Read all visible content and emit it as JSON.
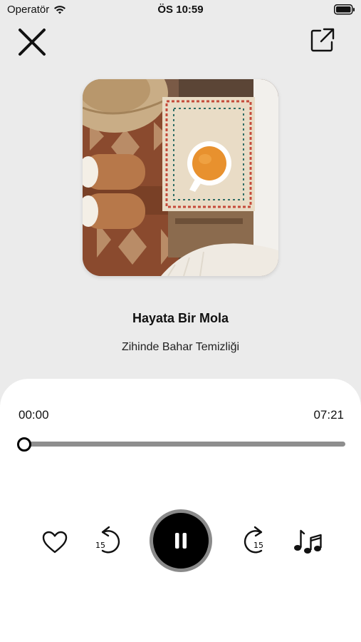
{
  "status_bar": {
    "carrier": "Operatör",
    "time": "ÖS 10:59"
  },
  "track": {
    "title": "Hayata Bir Mola",
    "subtitle": "Zihinde Bahar Temizliği"
  },
  "player": {
    "current_time": "00:00",
    "total_time": "07:21",
    "progress_fraction": 0.0,
    "skip_back_seconds": "15",
    "skip_forward_seconds": "15",
    "state": "playing"
  },
  "icons": {
    "close": "close-icon",
    "share": "share-icon",
    "like": "heart-icon",
    "rewind": "rewind-15-icon",
    "pause": "pause-icon",
    "forward": "forward-15-icon",
    "playlist": "music-notes-icon"
  },
  "colors": {
    "background": "#ebebeb",
    "sheet": "#ffffff",
    "accent": "#000000",
    "progress_track": "#8e8e8e",
    "play_ring": "#8a8a8a"
  }
}
